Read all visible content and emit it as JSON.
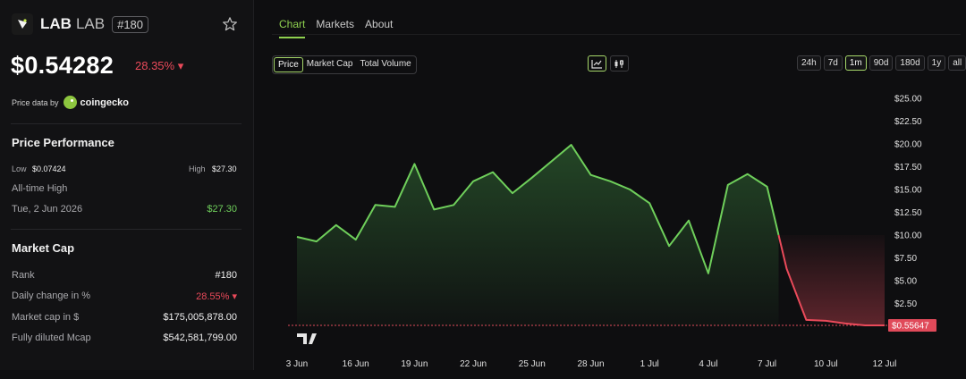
{
  "token": {
    "name": "LAB",
    "symbol": "LAB",
    "rank_badge": "#180",
    "price": "$0.54282",
    "change": "28.35% ▾",
    "price_data_label": "Price data by",
    "provider": "coingecko"
  },
  "performance": {
    "title": "Price Performance",
    "low_label": "Low",
    "low_value": "$0.07424",
    "high_label": "High",
    "high_value": "$27.30",
    "ath_label": "All-time High",
    "ath_date": "Tue, 2 Jun 2026",
    "ath_value": "$27.30"
  },
  "market_cap": {
    "title": "Market Cap",
    "rows": [
      {
        "label": "Rank",
        "value": "#180"
      },
      {
        "label": "Daily change in %",
        "value": "28.55% ▾"
      },
      {
        "label": "Market cap in $",
        "value": "$175,005,878.00"
      },
      {
        "label": "Fully diluted Mcap",
        "value": "$542,581,799.00"
      }
    ]
  },
  "tabs": [
    "Chart",
    "Markets",
    "About"
  ],
  "metrics": [
    "Price",
    "Market Cap",
    "Total Volume"
  ],
  "ranges": [
    "24h",
    "7d",
    "1m",
    "90d",
    "180d",
    "1y",
    "all"
  ],
  "view_icons": [
    "line-chart-icon",
    "candlestick-icon"
  ],
  "colors": {
    "up": "#6fcf5b",
    "down": "#ea4a5a",
    "accent": "#8fd14f"
  },
  "chart_data": {
    "type": "line",
    "current_label": "$0.55647",
    "baseline": 10.0,
    "ylim": [
      0,
      25
    ],
    "yticks": [
      "$25.00",
      "$22.50",
      "$20.00",
      "$17.50",
      "$15.00",
      "$12.50",
      "$10.00",
      "$7.50",
      "$5.00",
      "$2.50"
    ],
    "xticks": [
      "3 Jun",
      "16 Jun",
      "19 Jun",
      "22 Jun",
      "25 Jun",
      "28 Jun",
      "1 Jul",
      "4 Jul",
      "7 Jul",
      "10 Jul",
      "12 Jul"
    ],
    "x": [
      0,
      1,
      2,
      3,
      4,
      5,
      6,
      7,
      8,
      9,
      10,
      11,
      12,
      13,
      14,
      15,
      16,
      17,
      18,
      19,
      20,
      21,
      22,
      23,
      24,
      25,
      26,
      27,
      28,
      29,
      30
    ],
    "values": [
      9.8,
      9.3,
      11.1,
      9.5,
      13.3,
      13.1,
      17.8,
      12.8,
      13.3,
      15.9,
      16.9,
      14.6,
      16.3,
      18.1,
      19.9,
      16.6,
      15.9,
      15.0,
      13.5,
      8.8,
      11.6,
      5.8,
      15.5,
      16.7,
      15.3,
      6.3,
      0.7,
      0.6,
      0.3,
      0.1,
      0.1
    ]
  }
}
